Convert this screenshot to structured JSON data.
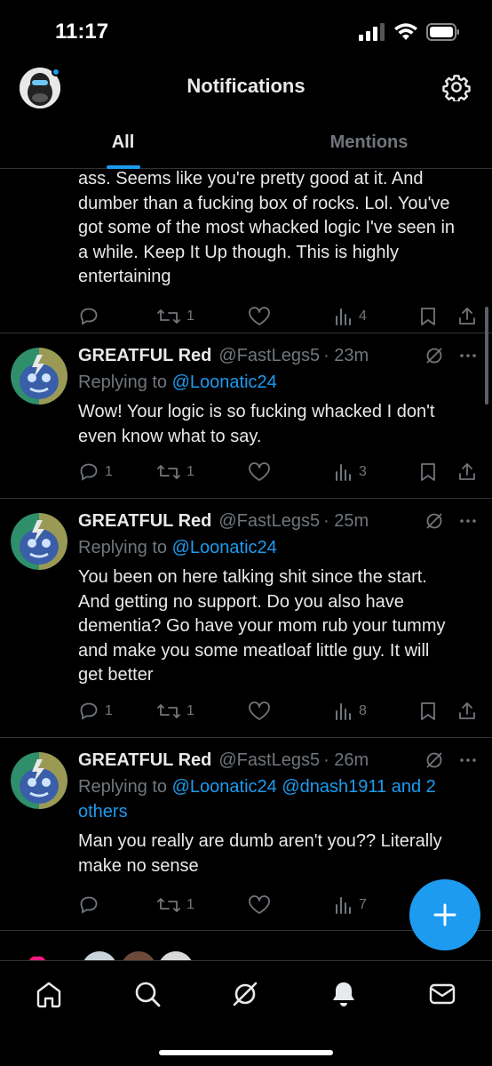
{
  "status_bar": {
    "time": "11:17"
  },
  "header": {
    "title": "Notifications"
  },
  "tabs": [
    {
      "label": "All",
      "active": true
    },
    {
      "label": "Mentions",
      "active": false
    }
  ],
  "partial_tweet": {
    "lines": [
      "ass. Seems like you're pretty good at it. And",
      "dumber than a fucking box of rocks. Lol. You've",
      "got some of the most whacked logic I've seen in",
      "a while. Keep It Up though. This is highly",
      "entertaining"
    ],
    "reply_count": "",
    "retweet_count": "1",
    "like_count": "",
    "view_count": "4"
  },
  "tweets": [
    {
      "name": "GREATFUL Red",
      "handle": "@FastLegs5",
      "time": "· 23m",
      "replying_prefix": "Replying to",
      "mentions": "@Loonatic24",
      "mentions_line2": "",
      "text_lines": [
        "Wow! Your logic is so fucking whacked I don't",
        "even know what to say."
      ],
      "reply_count": "1",
      "retweet_count": "1",
      "like_count": "",
      "view_count": "3"
    },
    {
      "name": "GREATFUL Red",
      "handle": "@FastLegs5",
      "time": "· 25m",
      "replying_prefix": "Replying to",
      "mentions": "@Loonatic24",
      "mentions_line2": "",
      "text_lines": [
        "You been on here talking shit since the start.",
        "And getting no support. Do you also have",
        "dementia? Go have your mom rub your tummy",
        "and make you some meatloaf little guy. It will",
        "get better"
      ],
      "reply_count": "1",
      "retweet_count": "1",
      "like_count": "",
      "view_count": "8"
    },
    {
      "name": "GREATFUL Red",
      "handle": "@FastLegs5",
      "time": "· 26m",
      "replying_prefix": "Replying to",
      "mentions": "@Loonatic24 @dnash1911 and 2",
      "mentions_line2": "others",
      "text_lines": [
        "Man you really are dumb aren't you?? Literally",
        "make no sense"
      ],
      "reply_count": "",
      "retweet_count": "1",
      "like_count": "",
      "view_count": "7"
    }
  ],
  "icons": {
    "reply": "reply-icon",
    "retweet": "retweet-icon",
    "like": "heart-icon",
    "views": "views-icon",
    "bookmark": "bookmark-icon",
    "share": "share-icon",
    "grok": "grok-icon",
    "more": "more-icon"
  },
  "bottom_nav": [
    "home-icon",
    "search-icon",
    "grok-icon",
    "notifications-icon",
    "messages-icon"
  ],
  "colors": {
    "accent": "#1d9bf0",
    "background": "#000000",
    "muted": "#71767b",
    "text": "#e7e9ea"
  }
}
